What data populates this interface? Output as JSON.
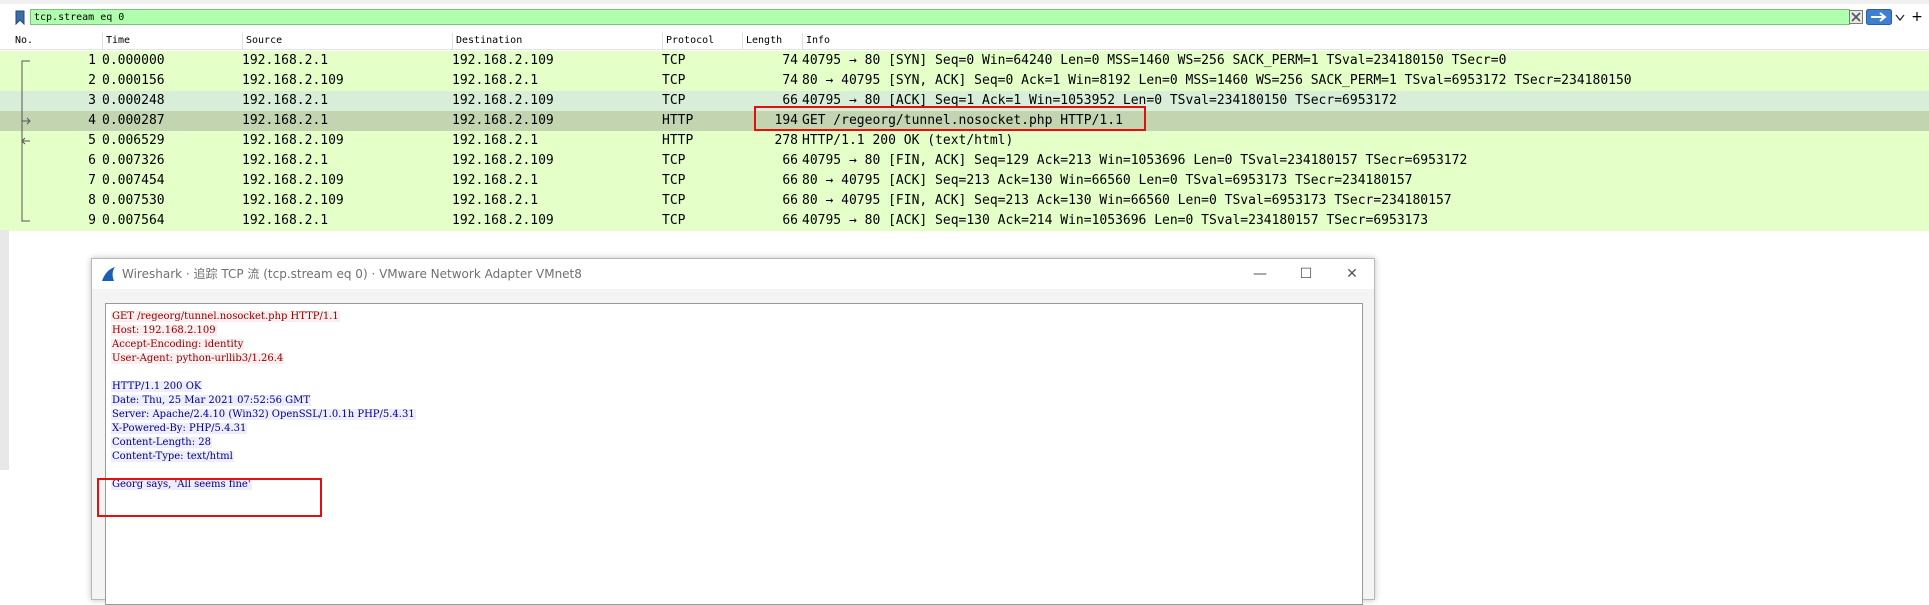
{
  "filter": {
    "value": "tcp.stream eq 0",
    "icon": "bookmark-icon"
  },
  "columns": [
    "No.",
    "Time",
    "Source",
    "Destination",
    "Protocol",
    "Length",
    "Info"
  ],
  "packets": [
    {
      "no": "1",
      "time": "0.000000",
      "src": "192.168.2.1",
      "dst": "192.168.2.109",
      "proto": "TCP",
      "len": "74",
      "info": "40795 → 80 [SYN] Seq=0 Win=64240 Len=0 MSS=1460 WS=256 SACK_PERM=1 TSval=234180150 TSecr=0",
      "color": "#e4ffc7"
    },
    {
      "no": "2",
      "time": "0.000156",
      "src": "192.168.2.109",
      "dst": "192.168.2.1",
      "proto": "TCP",
      "len": "74",
      "info": "80 → 40795 [SYN, ACK] Seq=0 Ack=1 Win=8192 Len=0 MSS=1460 WS=256 SACK_PERM=1 TSval=6953172 TSecr=234180150",
      "color": "#e4ffc7"
    },
    {
      "no": "3",
      "time": "0.000248",
      "src": "192.168.2.1",
      "dst": "192.168.2.109",
      "proto": "TCP",
      "len": "66",
      "info": "40795 → 80 [ACK] Seq=1 Ack=1 Win=1053952 Len=0 TSval=234180150 TSecr=6953172",
      "color": "#d8eed9"
    },
    {
      "no": "4",
      "time": "0.000287",
      "src": "192.168.2.1",
      "dst": "192.168.2.109",
      "proto": "HTTP",
      "len": "194",
      "info": "GET /regeorg/tunnel.nosocket.php HTTP/1.1",
      "color": "#c2d4b0"
    },
    {
      "no": "5",
      "time": "0.006529",
      "src": "192.168.2.109",
      "dst": "192.168.2.1",
      "proto": "HTTP",
      "len": "278",
      "info": "HTTP/1.1 200 OK  (text/html)",
      "color": "#e4ffc7"
    },
    {
      "no": "6",
      "time": "0.007326",
      "src": "192.168.2.1",
      "dst": "192.168.2.109",
      "proto": "TCP",
      "len": "66",
      "info": "40795 → 80 [FIN, ACK] Seq=129 Ack=213 Win=1053696 Len=0 TSval=234180157 TSecr=6953172",
      "color": "#e4ffc7"
    },
    {
      "no": "7",
      "time": "0.007454",
      "src": "192.168.2.109",
      "dst": "192.168.2.1",
      "proto": "TCP",
      "len": "66",
      "info": "80 → 40795 [ACK] Seq=213 Ack=130 Win=66560 Len=0 TSval=6953173 TSecr=234180157",
      "color": "#e4ffc7"
    },
    {
      "no": "8",
      "time": "0.007530",
      "src": "192.168.2.109",
      "dst": "192.168.2.1",
      "proto": "TCP",
      "len": "66",
      "info": "80 → 40795 [FIN, ACK] Seq=213 Ack=130 Win=66560 Len=0 TSval=6953173 TSecr=234180157",
      "color": "#e4ffc7"
    },
    {
      "no": "9",
      "time": "0.007564",
      "src": "192.168.2.1",
      "dst": "192.168.2.109",
      "proto": "TCP",
      "len": "66",
      "info": "40795 → 80 [ACK] Seq=130 Ack=214 Win=1053696 Len=0 TSval=234180157 TSecr=6953173",
      "color": "#e4ffc7"
    }
  ],
  "window": {
    "title": "Wireshark · 追踪 TCP 流 (tcp.stream eq 0) · VMware Network Adapter VMnet8",
    "icon": "wireshark-fin-icon",
    "minimize": "—",
    "maximize": "☐",
    "close": "✕"
  },
  "stream": {
    "request": [
      "GET /regeorg/tunnel.nosocket.php HTTP/1.1",
      "Host: 192.168.2.109",
      "Accept-Encoding: identity",
      "User-Agent: python-urllib3/1.26.4"
    ],
    "response": [
      "HTTP/1.1 200 OK",
      "Date: Thu, 25 Mar 2021 07:52:56 GMT",
      "Server: Apache/2.4.10 (Win32) OpenSSL/1.0.1h PHP/5.4.31",
      "X-Powered-By: PHP/5.4.31",
      "Content-Length: 28",
      "Content-Type: text/html"
    ],
    "body": "Georg says, 'All seems fine'"
  },
  "colors": {
    "filter_ok": "#afffaf",
    "highlight": "#e31010",
    "request_text": "#8b0000",
    "response_text": "#00008b"
  }
}
